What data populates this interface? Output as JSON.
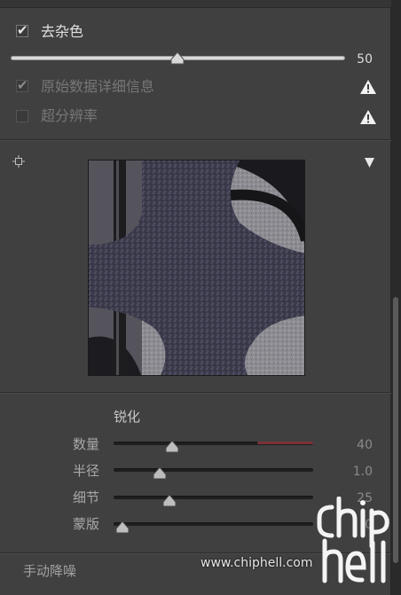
{
  "noise": {
    "checkbox_label": "去杂色",
    "checked": true,
    "value": "50",
    "level": 0.5
  },
  "options": [
    {
      "label": "原始数据详细信息",
      "checked": true,
      "disabled": true,
      "warning": true
    },
    {
      "label": "超分辨率",
      "checked": false,
      "disabled": true,
      "warning": true
    }
  ],
  "preview": {
    "menu_icon": "triangle-down-icon",
    "target_icon": "crosshair-icon"
  },
  "sharpen": {
    "title": "锐化",
    "sliders": [
      {
        "label": "数量",
        "value": "40",
        "level": 0.27
      },
      {
        "label": "半径",
        "value": "1.0",
        "level": 0.23
      },
      {
        "label": "细节",
        "value": "25",
        "level": 0.27
      },
      {
        "label": "蒙版",
        "value": "0",
        "level": 0.0
      }
    ]
  },
  "manual_noise": {
    "label": "手动降噪"
  },
  "watermark": {
    "text": "www.chiphell.com",
    "logo_text": "chip hell"
  },
  "colors": {
    "panel": "#404040",
    "accent_red": "#b0484f"
  }
}
